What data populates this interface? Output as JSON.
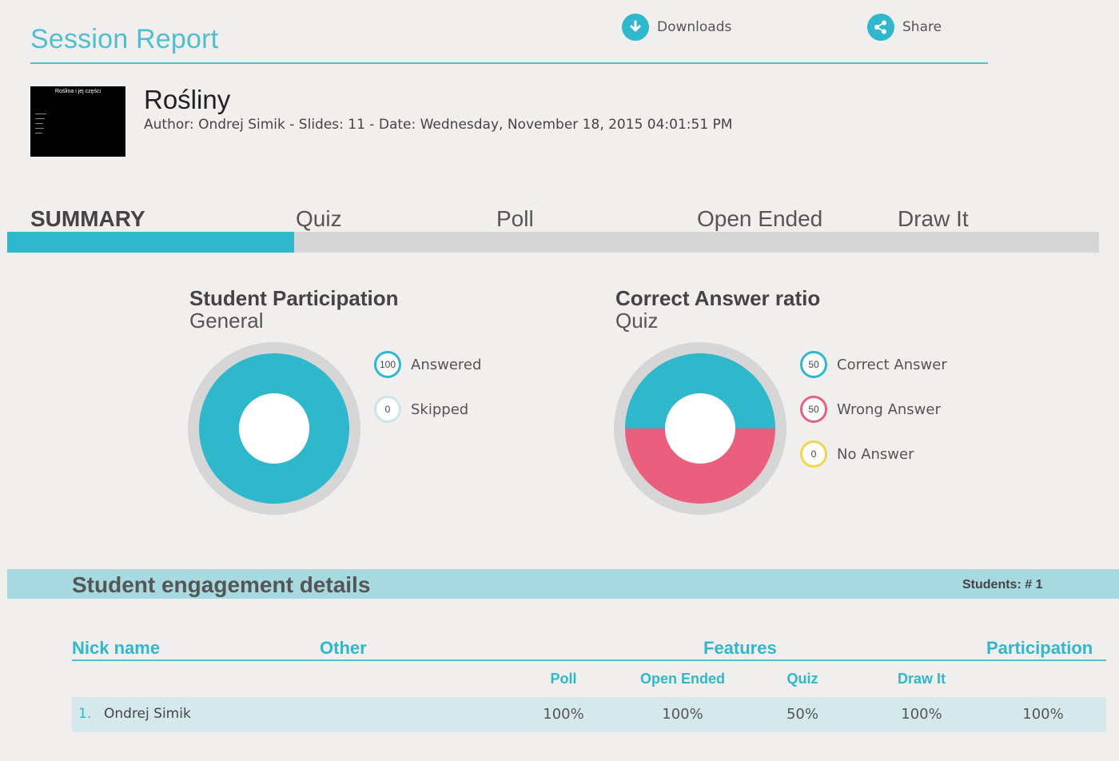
{
  "header": {
    "title": "Session Report",
    "downloads_label": "Downloads",
    "share_label": "Share"
  },
  "presentation": {
    "thumbnail_title": "Roślina i jej części",
    "name": "Rośliny",
    "meta": "Author: Ondrej Simik - Slides: 11 - Date: Wednesday, November 18, 2015 04:01:51 PM"
  },
  "tabs": [
    {
      "label": "SUMMARY",
      "active": true
    },
    {
      "label": "Quiz",
      "active": false
    },
    {
      "label": "Poll",
      "active": false
    },
    {
      "label": "Open Ended",
      "active": false
    },
    {
      "label": "Draw It",
      "active": false
    }
  ],
  "colors": {
    "accent": "#2fb7cb",
    "wrong": "#ea5f7e",
    "no_answer": "#f2d54a",
    "track": "#d6d6d6",
    "skipped_ring": "#c9e6ea"
  },
  "charts": {
    "participation": {
      "title": "Student Participation",
      "subtitle": "General",
      "legend": [
        {
          "value": "100",
          "label": "Answered"
        },
        {
          "value": "0",
          "label": "Skipped"
        }
      ]
    },
    "correct_ratio": {
      "title": "Correct Answer ratio",
      "subtitle": "Quiz",
      "legend": [
        {
          "value": "50",
          "label": "Correct Answer"
        },
        {
          "value": "50",
          "label": "Wrong Answer"
        },
        {
          "value": "0",
          "label": "No Answer"
        }
      ]
    }
  },
  "chart_data": [
    {
      "type": "pie",
      "title": "Student Participation",
      "subtitle": "General",
      "categories": [
        "Answered",
        "Skipped"
      ],
      "values": [
        100,
        0
      ]
    },
    {
      "type": "pie",
      "title": "Correct Answer ratio",
      "subtitle": "Quiz",
      "categories": [
        "Correct Answer",
        "Wrong Answer",
        "No Answer"
      ],
      "values": [
        50,
        50,
        0
      ]
    }
  ],
  "engagement": {
    "title": "Student engagement details",
    "students_count": "Students: # 1",
    "headers": {
      "nick": "Nick name",
      "other": "Other",
      "features": "Features",
      "participation": "Participation"
    },
    "subheaders": [
      "Poll",
      "Open Ended",
      "Quiz",
      "Draw It"
    ],
    "rows": [
      {
        "index": "1.",
        "name": "Ondrej Simik",
        "poll": "100%",
        "open_ended": "100%",
        "quiz": "50%",
        "draw_it": "100%",
        "participation": "100%"
      }
    ]
  }
}
